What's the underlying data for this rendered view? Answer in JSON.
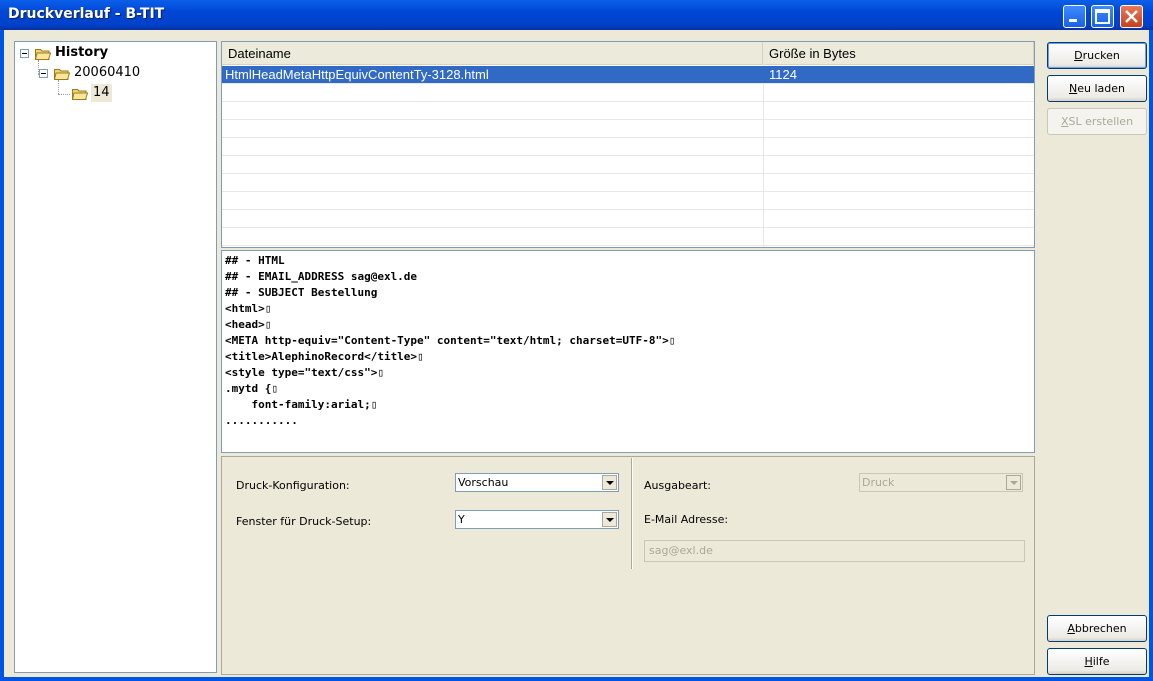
{
  "window": {
    "title": "Druckverlauf - B-TIT"
  },
  "tree": {
    "root": "History",
    "child": "20060410",
    "grandchild": "14"
  },
  "file_list": {
    "columns": [
      "Dateiname",
      "Größe in Bytes"
    ],
    "rows": [
      {
        "name": "HtmlHeadMetaHttpEquivContentTy-3128.html",
        "size": "1124",
        "selected": true
      }
    ]
  },
  "preview": {
    "lines": [
      "## - HTML",
      "## - EMAIL_ADDRESS sag@exl.de",
      "## - SUBJECT Bestellung",
      "<html>▯",
      "<head>▯",
      "<META http-equiv=\"Content-Type\" content=\"text/html; charset=UTF-8\">▯",
      "<title>AlephinoRecord</title>▯",
      "<style type=\"text/css\">▯",
      ".mytd {▯",
      "    font-family:arial;▯",
      "..........."
    ]
  },
  "config": {
    "druck_konfiguration_label": "Druck-Konfiguration:",
    "druck_konfiguration_value": "Vorschau",
    "fenster_label": "Fenster für Druck-Setup:",
    "fenster_value": "Y",
    "ausgabeart_label": "Ausgabeart:",
    "ausgabeart_value": "Druck",
    "email_label": "E-Mail Adresse:",
    "email_value": "sag@exl.de"
  },
  "buttons": {
    "drucken": {
      "pre": "",
      "key": "D",
      "post": "rucken"
    },
    "neu_laden": {
      "pre": "",
      "key": "N",
      "post": "eu laden"
    },
    "xsl_erstellen": {
      "pre": "",
      "key": "X",
      "post": "SL erstellen"
    },
    "abbrechen": {
      "pre": "",
      "key": "A",
      "post": "bbrechen"
    },
    "hilfe": {
      "pre": "",
      "key": "H",
      "post": "ilfe"
    }
  },
  "colors": {
    "titlebar": "#0054e3",
    "selection": "#316ac5",
    "face": "#ece9d8"
  }
}
